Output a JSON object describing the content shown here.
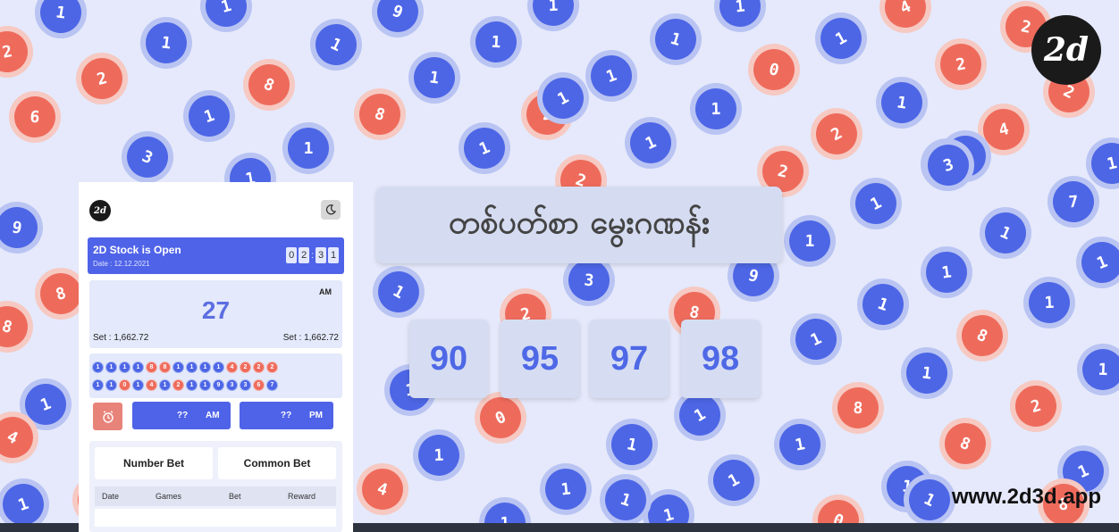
{
  "background_balls": [
    {
      "n": "1",
      "c": "blue"
    },
    {
      "n": "1",
      "c": "blue"
    },
    {
      "n": "1",
      "c": "blue"
    },
    {
      "n": "9",
      "c": "blue"
    },
    {
      "n": "1",
      "c": "blue"
    },
    {
      "n": "4",
      "c": "red"
    },
    {
      "n": "2",
      "c": "red"
    },
    {
      "n": "2",
      "c": "red"
    },
    {
      "n": "1",
      "c": "blue"
    },
    {
      "n": "1",
      "c": "blue"
    },
    {
      "n": "1",
      "c": "blue"
    },
    {
      "n": "1",
      "c": "blue"
    },
    {
      "n": "1",
      "c": "blue"
    },
    {
      "n": "1",
      "c": "blue"
    },
    {
      "n": "1",
      "c": "blue"
    },
    {
      "n": "2",
      "c": "red"
    },
    {
      "n": "8",
      "c": "red"
    },
    {
      "n": "1",
      "c": "blue"
    },
    {
      "n": "1",
      "c": "blue"
    },
    {
      "n": "0",
      "c": "red"
    },
    {
      "n": "2",
      "c": "red"
    },
    {
      "n": "2",
      "c": "red"
    },
    {
      "n": "6",
      "c": "red"
    },
    {
      "n": "1",
      "c": "blue"
    },
    {
      "n": "8",
      "c": "red"
    },
    {
      "n": "2",
      "c": "red"
    },
    {
      "n": "2",
      "c": "red"
    },
    {
      "n": "1",
      "c": "blue"
    },
    {
      "n": "4",
      "c": "red"
    },
    {
      "n": "3",
      "c": "blue"
    },
    {
      "n": "1",
      "c": "blue"
    },
    {
      "n": "1",
      "c": "blue"
    },
    {
      "n": "2",
      "c": "red"
    },
    {
      "n": "1",
      "c": "blue"
    },
    {
      "n": "1",
      "c": "blue"
    },
    {
      "n": "1",
      "c": "blue"
    },
    {
      "n": "3",
      "c": "blue"
    },
    {
      "n": "2",
      "c": "red"
    },
    {
      "n": "7",
      "c": "blue"
    },
    {
      "n": "1",
      "c": "blue"
    },
    {
      "n": "9",
      "c": "blue"
    },
    {
      "n": "1",
      "c": "blue"
    },
    {
      "n": "1",
      "c": "blue"
    },
    {
      "n": "1",
      "c": "blue"
    },
    {
      "n": "1",
      "c": "blue"
    },
    {
      "n": "9",
      "c": "blue"
    },
    {
      "n": "1",
      "c": "blue"
    },
    {
      "n": "1",
      "c": "blue"
    },
    {
      "n": "3",
      "c": "blue"
    },
    {
      "n": "8",
      "c": "red"
    },
    {
      "n": "1",
      "c": "blue"
    },
    {
      "n": "1",
      "c": "blue"
    },
    {
      "n": "1",
      "c": "blue"
    },
    {
      "n": "8",
      "c": "red"
    },
    {
      "n": "2",
      "c": "red"
    },
    {
      "n": "8",
      "c": "red"
    },
    {
      "n": "1",
      "c": "blue"
    },
    {
      "n": "1",
      "c": "blue"
    },
    {
      "n": "8",
      "c": "red"
    },
    {
      "n": "1",
      "c": "blue"
    },
    {
      "n": "1",
      "c": "blue"
    },
    {
      "n": "1",
      "c": "blue"
    },
    {
      "n": "2",
      "c": "red"
    },
    {
      "n": "8",
      "c": "red"
    },
    {
      "n": "1",
      "c": "blue"
    },
    {
      "n": "0",
      "c": "red"
    },
    {
      "n": "1",
      "c": "blue"
    },
    {
      "n": "1",
      "c": "blue"
    },
    {
      "n": "4",
      "c": "red"
    },
    {
      "n": "8",
      "c": "red"
    },
    {
      "n": "1",
      "c": "blue"
    },
    {
      "n": "4",
      "c": "red"
    },
    {
      "n": "1",
      "c": "blue"
    },
    {
      "n": "1",
      "c": "blue"
    },
    {
      "n": "1",
      "c": "blue"
    },
    {
      "n": "1",
      "c": "blue"
    },
    {
      "n": "0",
      "c": "red"
    },
    {
      "n": "1",
      "c": "blue"
    },
    {
      "n": "1",
      "c": "blue"
    },
    {
      "n": "1",
      "c": "blue"
    },
    {
      "n": "1",
      "c": "blue"
    },
    {
      "n": "1",
      "c": "blue"
    },
    {
      "n": "8",
      "c": "red"
    },
    {
      "n": "4",
      "c": "red"
    },
    {
      "n": "1",
      "c": "blue"
    },
    {
      "n": "2",
      "c": "red"
    },
    {
      "n": "1",
      "c": "blue"
    },
    {
      "n": "1",
      "c": "blue"
    }
  ],
  "brand": {
    "logo_text": "2d",
    "website": "www.2d3d.app"
  },
  "headline": "တစ်ပတ်စာ မွေးဂဏန်း",
  "lucky_numbers": [
    "90",
    "95",
    "97",
    "98"
  ],
  "app": {
    "logo_text": "2d",
    "theme_icon": "moon-icon",
    "status_title": "2D Stock is Open",
    "status_date": "Date : 12.12.2021",
    "timer_digits": [
      "0",
      "2",
      "3",
      "1"
    ],
    "session": "AM",
    "result": "27",
    "set_left": "Set : 1,662.72",
    "set_right": "Set : 1,662.72",
    "dot_rows": [
      [
        {
          "n": "1",
          "c": "b"
        },
        {
          "n": "1",
          "c": "b"
        },
        {
          "n": "1",
          "c": "b"
        },
        {
          "n": "1",
          "c": "b"
        },
        {
          "n": "8",
          "c": "r"
        },
        {
          "n": "8",
          "c": "r"
        },
        {
          "n": "1",
          "c": "b"
        },
        {
          "n": "1",
          "c": "b"
        },
        {
          "n": "1",
          "c": "b"
        },
        {
          "n": "1",
          "c": "b"
        },
        {
          "n": "4",
          "c": "r"
        },
        {
          "n": "2",
          "c": "r"
        },
        {
          "n": "2",
          "c": "r"
        },
        {
          "n": "2",
          "c": "r"
        }
      ],
      [
        {
          "n": "1",
          "c": "b"
        },
        {
          "n": "1",
          "c": "b"
        },
        {
          "n": "0",
          "c": "r"
        },
        {
          "n": "1",
          "c": "b"
        },
        {
          "n": "4",
          "c": "r"
        },
        {
          "n": "1",
          "c": "b"
        },
        {
          "n": "2",
          "c": "r"
        },
        {
          "n": "1",
          "c": "b"
        },
        {
          "n": "1",
          "c": "b"
        },
        {
          "n": "9",
          "c": "b"
        },
        {
          "n": "3",
          "c": "b"
        },
        {
          "n": "3",
          "c": "b"
        },
        {
          "n": "6",
          "c": "r"
        },
        {
          "n": "7",
          "c": "b"
        }
      ]
    ],
    "alarm_icon": "alarm-clock-icon",
    "slot_am": {
      "value": "??",
      "label": "AM"
    },
    "slot_pm": {
      "value": "??",
      "label": "PM"
    },
    "tabs": [
      "Number Bet",
      "Common Bet"
    ],
    "table_headers": [
      "Date",
      "Games",
      "Bet",
      "Reward"
    ]
  },
  "colors": {
    "blue": "#4d66e6",
    "red": "#ee6b5c",
    "background": "#e5e9fb"
  }
}
